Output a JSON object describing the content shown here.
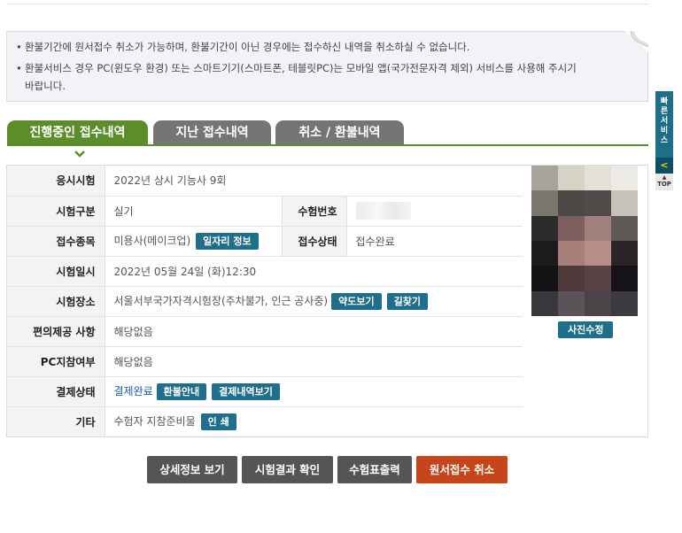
{
  "notice": {
    "items": [
      "환불기간에 원서접수 취소가 가능하며, 환불기간이 아닌 경우에는 접수하신 내역을 취소하실 수 없습니다.",
      "환불서비스 경우 PC(윈도우 환경) 또는 스마트기기(스마트폰, 테블릿PC)는 모바일 앱(국가전문자격 제외) 서비스를 사용해 주시기 바랍니다."
    ]
  },
  "tabs": {
    "active": "진행중인 접수내역",
    "past": "지난 접수내역",
    "refund": "취소 / 환불내역"
  },
  "labels": {
    "exam": "응시시험",
    "type": "시험구분",
    "exam_no": "수험번호",
    "category": "접수종목",
    "status": "접수상태",
    "datetime": "시험일시",
    "place": "시험장소",
    "convenience": "편의제공 사항",
    "pc": "PC지참여부",
    "payment": "결제상태",
    "etc": "기타"
  },
  "values": {
    "exam": "2022년 상시 기능사 9회",
    "type": "실기",
    "category": "미용사(메이크업)",
    "status": "접수완료",
    "datetime": "2022년 05월 24일 (화)12:30",
    "place": "서울서부국가자격시험장(주차불가, 인근 공사중)",
    "convenience": "해당없음",
    "pc": "해당없음",
    "payment": "결제완료",
    "etc": "수험자 지참준비물"
  },
  "buttons": {
    "job_info": "일자리 정보",
    "map": "약도보기",
    "directions": "길찾기",
    "refund_guide": "환불안내",
    "payment_history": "결제내역보기",
    "print": "인 쇄",
    "photo_edit": "사진수정"
  },
  "actions": {
    "detail": "상세정보 보기",
    "result": "시험결과 확인",
    "ticket": "수험표출력",
    "cancel": "원서접수 취소"
  },
  "quick": {
    "label": "빠른서비스",
    "toggle": "<",
    "top": "TOP"
  },
  "colors": {
    "accent_green": "#5b8d2b",
    "tab_gray": "#757575",
    "button_teal": "#1f6e8c",
    "cancel_red": "#c6451a",
    "link_blue": "#1a5aa8"
  }
}
